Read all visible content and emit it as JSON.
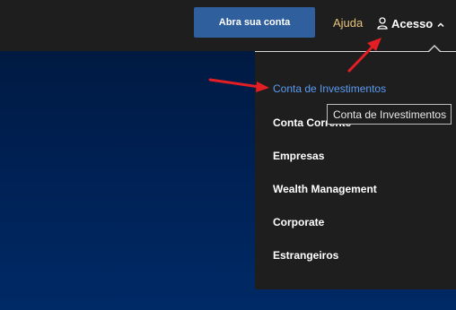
{
  "header": {
    "cta_label": "Abra sua conta",
    "help_label": "Ajuda",
    "account_label": "Acesso"
  },
  "dropdown": {
    "items": [
      {
        "label": "Conta de Investimentos",
        "active": true
      },
      {
        "label": "Conta Corrente",
        "active": false
      },
      {
        "label": "Empresas",
        "active": false
      },
      {
        "label": "Wealth Management",
        "active": false
      },
      {
        "label": "Corporate",
        "active": false
      },
      {
        "label": "Estrangeiros",
        "active": false
      }
    ]
  },
  "tooltip": {
    "text": "Conta de Investimentos"
  },
  "colors": {
    "cta_background": "#305f9d",
    "active_item": "#5b9bf0",
    "help_link": "#e6c47a",
    "annotation_arrow": "#e31e24",
    "hero_background": "#002257"
  }
}
